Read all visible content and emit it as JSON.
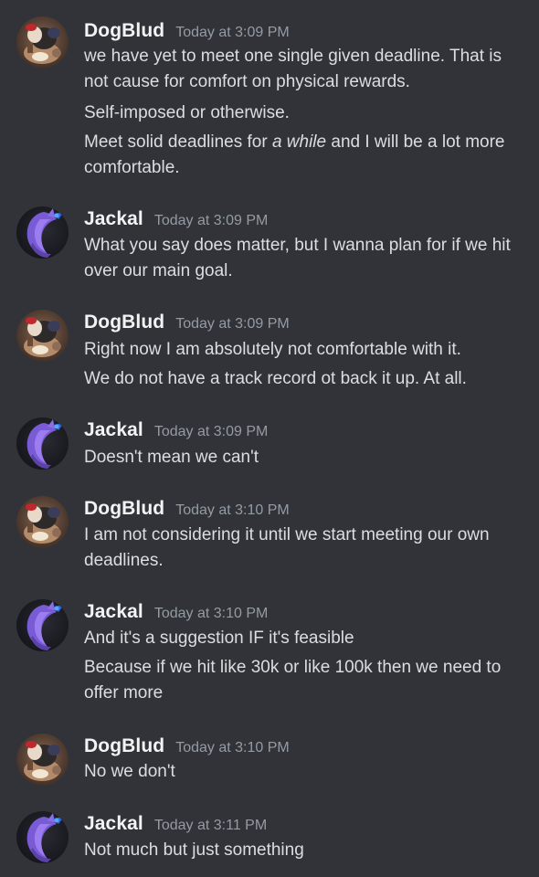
{
  "messages": [
    {
      "user": "DogBlud",
      "time": "Today at 3:09 PM",
      "lines": [
        "we have yet to meet one single given deadline. That is not cause for comfort on physical rewards.",
        "Self-imposed or otherwise."
      ],
      "rich_line": {
        "before": "Meet solid deadlines for ",
        "emphasis": "a while",
        "after": " and I will be a lot more comfortable."
      }
    },
    {
      "user": "Jackal",
      "time": "Today at 3:09 PM",
      "lines": [
        "What you say does matter, but I wanna plan for if we hit over our main goal."
      ]
    },
    {
      "user": "DogBlud",
      "time": "Today at 3:09 PM",
      "lines": [
        "Right now I am absolutely not comfortable with it.",
        "We do not have a track record ot back it up. At all."
      ]
    },
    {
      "user": "Jackal",
      "time": "Today at 3:09 PM",
      "lines": [
        "Doesn't mean we can't"
      ]
    },
    {
      "user": "DogBlud",
      "time": "Today at 3:10 PM",
      "lines": [
        "I am not considering it until we start meeting our own deadlines."
      ]
    },
    {
      "user": "Jackal",
      "time": "Today at 3:10 PM",
      "lines": [
        "And it's a suggestion IF it's feasible",
        "Because if we hit like 30k or like 100k then we need to offer more"
      ]
    },
    {
      "user": "DogBlud",
      "time": "Today at 3:10 PM",
      "lines": [
        "No we don't"
      ]
    },
    {
      "user": "Jackal",
      "time": "Today at 3:11 PM",
      "lines": [
        "Not much but just something"
      ]
    }
  ],
  "colors": {
    "background": "#313338",
    "username": "#f2f3f5",
    "timestamp": "#949ba4",
    "message_text": "#dbdee1"
  },
  "icons": {
    "dogblud_avatar": "dogblud-avatar-icon",
    "jackal_avatar": "jackal-avatar-icon"
  }
}
